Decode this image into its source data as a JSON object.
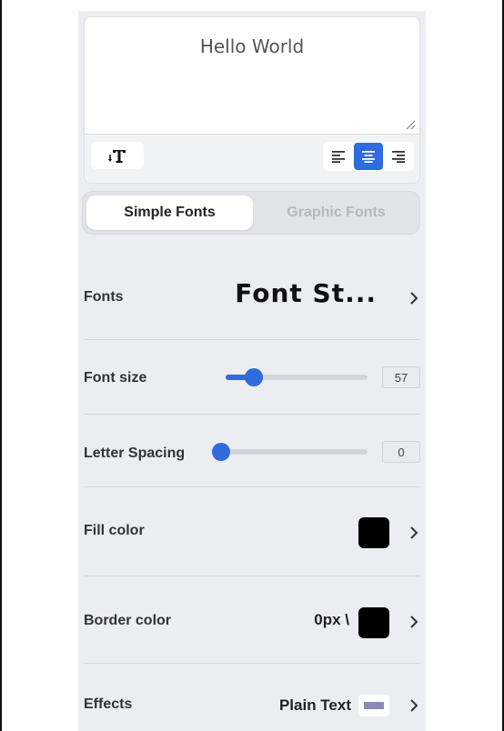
{
  "editor": {
    "text": "Hello World",
    "text_style_icon": "text-style-icon",
    "alignment": [
      "align-left",
      "align-center",
      "align-right"
    ],
    "active_alignment": "align-center"
  },
  "tabs": [
    {
      "label": "Simple Fonts",
      "active": true
    },
    {
      "label": "Graphic Fonts",
      "active": false
    }
  ],
  "fonts": {
    "label": "Fonts",
    "preview": "Font St..."
  },
  "font_size": {
    "label": "Font size",
    "value": "57",
    "slider_fraction": 0.2
  },
  "letter_spacing": {
    "label": "Letter Spacing",
    "value": "0",
    "slider_fraction": 0.0
  },
  "fill_color": {
    "label": "Fill color",
    "color": "#000000"
  },
  "border_color": {
    "label": "Border color",
    "value": "0px \\",
    "color": "#000000"
  },
  "effects": {
    "label": "Effects",
    "value": "Plain Text",
    "thumb_color": "#8a8db7"
  },
  "colors": {
    "accent": "#2f6bdc",
    "panel_bg": "#ecedf1"
  }
}
